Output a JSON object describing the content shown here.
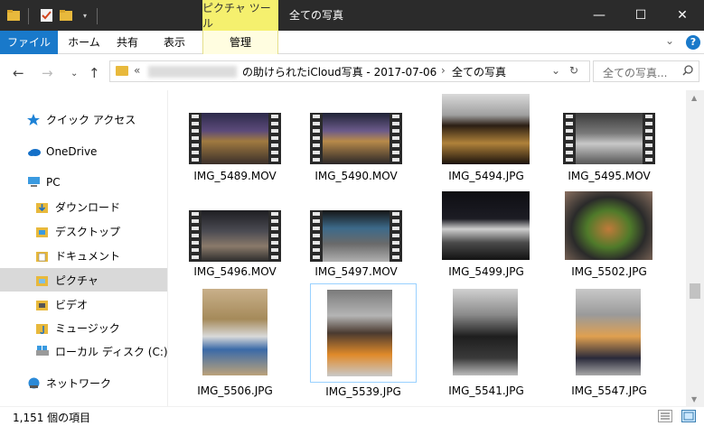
{
  "titlebar": {
    "context_tab": "ピクチャ ツール",
    "title": "全ての写真",
    "minimize": "—",
    "maximize": "☐",
    "close": "✕"
  },
  "ribbon": {
    "tabs": [
      "ファイル",
      "ホーム",
      "共有",
      "表示",
      "管理"
    ],
    "collapse": "⌄",
    "help": "?"
  },
  "address": {
    "overflow": "«",
    "segment1": "の助けられたiCloud写真 - 2017-07-06",
    "separator": "›",
    "segment2": "全ての写真",
    "dropdown": "⌄",
    "refresh": "↻"
  },
  "search": {
    "placeholder": "全ての写真..."
  },
  "sidebar": {
    "items": [
      {
        "label": "クイック アクセス",
        "icon": "star-icon"
      },
      {
        "label": "OneDrive",
        "icon": "cloud-icon"
      },
      {
        "label": "PC",
        "icon": "computer-icon"
      },
      {
        "label": "ダウンロード",
        "icon": "download-folder-icon"
      },
      {
        "label": "デスクトップ",
        "icon": "desktop-folder-icon"
      },
      {
        "label": "ドキュメント",
        "icon": "documents-folder-icon"
      },
      {
        "label": "ピクチャ",
        "icon": "pictures-folder-icon"
      },
      {
        "label": "ビデオ",
        "icon": "videos-folder-icon"
      },
      {
        "label": "ミュージック",
        "icon": "music-folder-icon"
      },
      {
        "label": "ローカル ディスク (C:)",
        "icon": "drive-icon"
      },
      {
        "label": "ネットワーク",
        "icon": "network-icon"
      }
    ]
  },
  "files": [
    {
      "name": "IMG_5489.MOV",
      "kind": "video"
    },
    {
      "name": "IMG_5490.MOV",
      "kind": "video"
    },
    {
      "name": "IMG_5494.JPG",
      "kind": "photo"
    },
    {
      "name": "IMG_5495.MOV",
      "kind": "video"
    },
    {
      "name": "IMG_5496.MOV",
      "kind": "video"
    },
    {
      "name": "IMG_5497.MOV",
      "kind": "video"
    },
    {
      "name": "IMG_5499.JPG",
      "kind": "photo"
    },
    {
      "name": "IMG_5502.JPG",
      "kind": "photo"
    },
    {
      "name": "IMG_5506.JPG",
      "kind": "photo"
    },
    {
      "name": "IMG_5539.JPG",
      "kind": "photo"
    },
    {
      "name": "IMG_5541.JPG",
      "kind": "photo"
    },
    {
      "name": "IMG_5547.JPG",
      "kind": "photo"
    }
  ],
  "status": {
    "count": "1,151 個の項目"
  },
  "colors": {
    "titlebar": "#2b2b2b",
    "context_tab": "#f5f06e",
    "file_tab": "#1979ca",
    "selection": "#d9d9d9",
    "selected_tile_border": "#99d1ff"
  }
}
